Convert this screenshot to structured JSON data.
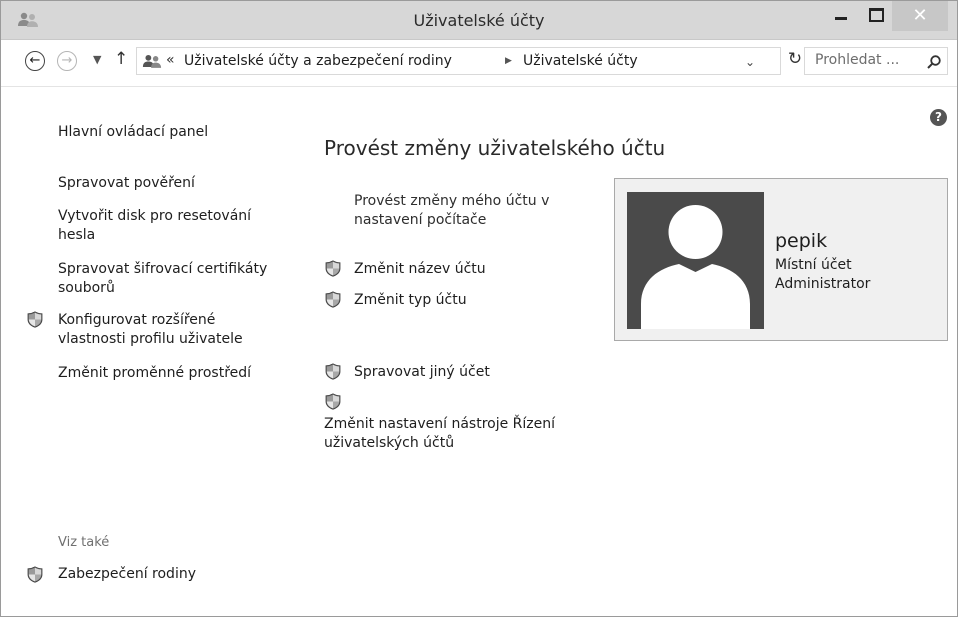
{
  "window": {
    "title": "Uživatelské účty"
  },
  "address": {
    "breadcrumb_parent": "Uživatelské účty a zabezpečení rodiny",
    "breadcrumb_current": "Uživatelské účty",
    "overflow_chevron": "«"
  },
  "search": {
    "placeholder": "Prohledat ..."
  },
  "help": {
    "label": "?"
  },
  "sidebar": {
    "links": [
      "Hlavní ovládací panel",
      "Spravovat pověření",
      "Vytvořit disk pro resetování hesla",
      "Spravovat šifrovací certifikáty souborů",
      "Konfigurovat rozšířené vlastnosti profilu uživatele",
      "Změnit proměnné prostředí"
    ],
    "see_also_heading": "Viz také",
    "see_also_links": [
      "Zabezpečení rodiny"
    ]
  },
  "main": {
    "title": "Provést změny uživatelského účtu",
    "change_my_account": "Provést změny mého účtu v nastavení počítače",
    "tasks": [
      "Změnit název účtu",
      "Změnit typ účtu",
      "Spravovat jiný účet",
      "Změnit nastavení nástroje Řízení uživatelských účtů"
    ]
  },
  "account": {
    "name": "pepik",
    "type": "Místní účet",
    "role": "Administrator"
  },
  "icons": {
    "shield": "uac-shield-icon",
    "avatar": "user-silhouette-icon"
  },
  "colors": {
    "titlebar": "#d7d7d7",
    "close_button": "#c7c7c7",
    "card_bg": "#f0f0f0",
    "avatar_bg": "#4a4a4a"
  }
}
